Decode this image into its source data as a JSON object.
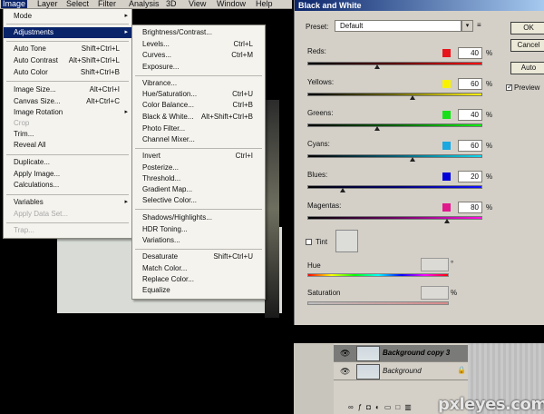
{
  "menubar": {
    "items": [
      "Image",
      "Layer",
      "Select",
      "Filter",
      "Analysis",
      "3D",
      "View",
      "Window",
      "Help"
    ]
  },
  "image_menu": {
    "items": [
      {
        "label": "Mode",
        "shortcut": "",
        "arrow": "▸"
      },
      {
        "label": "Adjustments",
        "shortcut": "",
        "arrow": "▸"
      },
      {
        "label": "Auto Tone",
        "shortcut": "Shift+Ctrl+L"
      },
      {
        "label": "Auto Contrast",
        "shortcut": "Alt+Shift+Ctrl+L"
      },
      {
        "label": "Auto Color",
        "shortcut": "Shift+Ctrl+B"
      },
      {
        "label": "Image Size...",
        "shortcut": "Alt+Ctrl+I"
      },
      {
        "label": "Canvas Size...",
        "shortcut": "Alt+Ctrl+C"
      },
      {
        "label": "Image Rotation",
        "shortcut": "",
        "arrow": "▸"
      },
      {
        "label": "Crop",
        "shortcut": ""
      },
      {
        "label": "Trim...",
        "shortcut": ""
      },
      {
        "label": "Reveal All",
        "shortcut": ""
      },
      {
        "label": "Duplicate...",
        "shortcut": ""
      },
      {
        "label": "Apply Image...",
        "shortcut": ""
      },
      {
        "label": "Calculations...",
        "shortcut": ""
      },
      {
        "label": "Variables",
        "shortcut": "",
        "arrow": "▸"
      },
      {
        "label": "Apply Data Set...",
        "shortcut": ""
      },
      {
        "label": "Trap...",
        "shortcut": ""
      }
    ]
  },
  "adjustments_menu": {
    "items": [
      {
        "label": "Brightness/Contrast...",
        "shortcut": ""
      },
      {
        "label": "Levels...",
        "shortcut": "Ctrl+L"
      },
      {
        "label": "Curves...",
        "shortcut": "Ctrl+M"
      },
      {
        "label": "Exposure...",
        "shortcut": ""
      },
      {
        "label": "Vibrance...",
        "shortcut": ""
      },
      {
        "label": "Hue/Saturation...",
        "shortcut": "Ctrl+U"
      },
      {
        "label": "Color Balance...",
        "shortcut": "Ctrl+B"
      },
      {
        "label": "Black & White...",
        "shortcut": "Alt+Shift+Ctrl+B"
      },
      {
        "label": "Photo Filter...",
        "shortcut": ""
      },
      {
        "label": "Channel Mixer...",
        "shortcut": ""
      },
      {
        "label": "Invert",
        "shortcut": "Ctrl+I"
      },
      {
        "label": "Posterize...",
        "shortcut": ""
      },
      {
        "label": "Threshold...",
        "shortcut": ""
      },
      {
        "label": "Gradient Map...",
        "shortcut": ""
      },
      {
        "label": "Selective Color...",
        "shortcut": ""
      },
      {
        "label": "Shadows/Highlights...",
        "shortcut": ""
      },
      {
        "label": "HDR Toning...",
        "shortcut": ""
      },
      {
        "label": "Variations...",
        "shortcut": ""
      },
      {
        "label": "Desaturate",
        "shortcut": "Shift+Ctrl+U"
      },
      {
        "label": "Match Color...",
        "shortcut": ""
      },
      {
        "label": "Replace Color...",
        "shortcut": ""
      },
      {
        "label": "Equalize",
        "shortcut": ""
      }
    ]
  },
  "bw_dialog": {
    "title": "Black and White",
    "preset_label": "Preset:",
    "preset_value": "Default",
    "sliders": [
      {
        "label": "Reds:",
        "value": "40",
        "pct": "%",
        "swatch": "#e8141b",
        "gradient": "linear-gradient(90deg,#000,#5a0000,#ff1010)",
        "pos": 0.4
      },
      {
        "label": "Yellows:",
        "value": "60",
        "pct": "%",
        "swatch": "#f8f200",
        "gradient": "linear-gradient(90deg,#000,#6a6400,#fff200)",
        "pos": 0.6
      },
      {
        "label": "Greens:",
        "value": "40",
        "pct": "%",
        "swatch": "#18e018",
        "gradient": "linear-gradient(90deg,#000,#006000,#10f010)",
        "pos": 0.4
      },
      {
        "label": "Cyans:",
        "value": "60",
        "pct": "%",
        "swatch": "#1aa8e0",
        "gradient": "linear-gradient(90deg,#000,#005a70,#10d8f0)",
        "pos": 0.6
      },
      {
        "label": "Blues:",
        "value": "20",
        "pct": "%",
        "swatch": "#0000d8",
        "gradient": "linear-gradient(90deg,#000,#00006a,#1010ff)",
        "pos": 0.2
      },
      {
        "label": "Magentas:",
        "value": "80",
        "pct": "%",
        "swatch": "#e0188c",
        "gradient": "linear-gradient(90deg,#000,#6a0060,#ff10e0)",
        "pos": 0.8
      }
    ],
    "tint_label": "Tint",
    "hue_label": "Hue",
    "hue_unit": "°",
    "saturation_label": "Saturation",
    "saturation_unit": "%",
    "buttons": {
      "ok": "OK",
      "cancel": "Cancel",
      "auto": "Auto"
    },
    "preview_label": "Preview"
  },
  "layers": {
    "rows": [
      {
        "name": "Background copy 3",
        "selected": true
      },
      {
        "name": "Background",
        "selected": false
      }
    ]
  },
  "watermark": "pxleyes.com"
}
